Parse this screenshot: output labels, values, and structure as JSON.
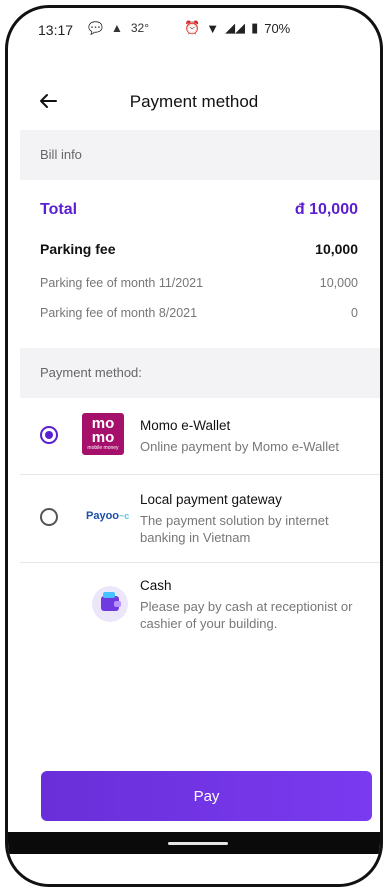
{
  "status_bar": {
    "time": "13:17",
    "temperature": "32°",
    "battery": "70%"
  },
  "header": {
    "title": "Payment method"
  },
  "bill_info": {
    "section_label": "Bill info",
    "total_label": "Total",
    "total_value": "đ 10,000",
    "parking_fee_label": "Parking fee",
    "parking_fee_value": "10,000",
    "items": [
      {
        "label": "Parking fee of month 11/2021",
        "value": "10,000"
      },
      {
        "label": "Parking fee of month 8/2021",
        "value": "0"
      }
    ]
  },
  "payment": {
    "section_label": "Payment method:",
    "methods": [
      {
        "name": "Momo e-Wallet",
        "description": "Online payment by Momo e-Wallet",
        "selected": true,
        "logo_text": "mo\nmo",
        "logo_small": "mobile money"
      },
      {
        "name": "Local payment gateway",
        "description": "The payment solution by internet banking in Vietnam",
        "selected": false,
        "logo_text": "Payoo"
      },
      {
        "name": "Cash",
        "description": "Please pay by cash at receptionist or cashier of your building.",
        "selected": false
      }
    ]
  },
  "pay_button": "Pay",
  "colors": {
    "accent": "#5a1fd0",
    "momo": "#a5106a",
    "section_bg": "#f3f3f5"
  }
}
